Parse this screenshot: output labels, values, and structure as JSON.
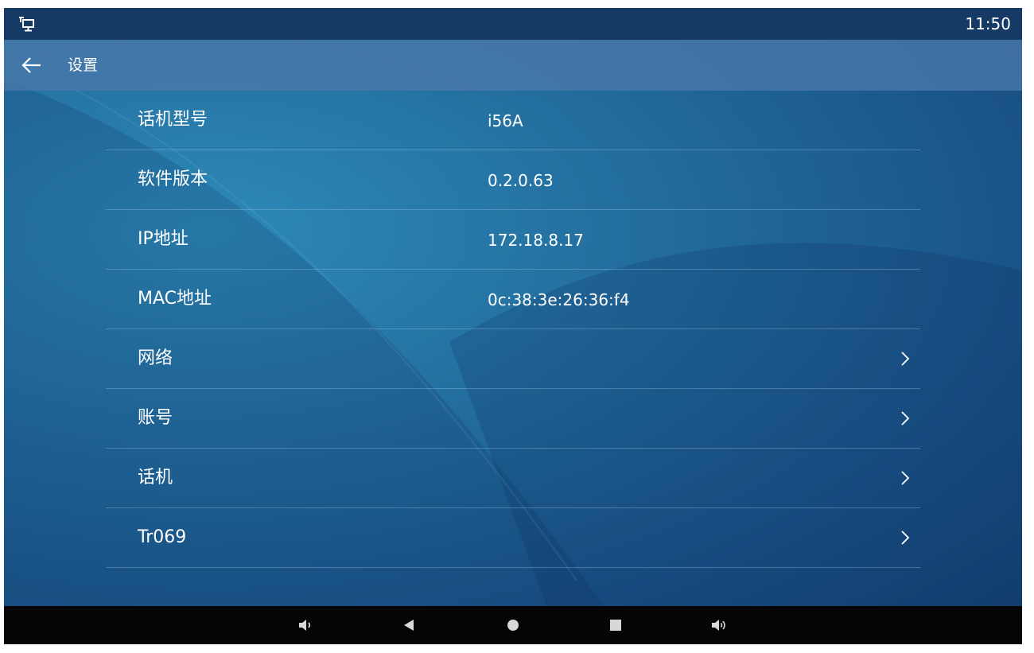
{
  "status_bar": {
    "time": "11:50",
    "left_icon": "network-monitor-icon"
  },
  "app_bar": {
    "back_icon": "arrow-left-icon",
    "title": "设置"
  },
  "settings": {
    "items": [
      {
        "label": "话机型号",
        "value": "i56A"
      },
      {
        "label": "软件版本",
        "value": "0.2.0.63"
      },
      {
        "label": "IP地址",
        "value": "172.18.8.17"
      },
      {
        "label": "MAC地址",
        "value": "0c:38:3e:26:36:f4"
      },
      {
        "label": "网络",
        "chevron_icon": "chevron-right-icon"
      },
      {
        "label": "账号",
        "chevron_icon": "chevron-right-icon"
      },
      {
        "label": "话机",
        "chevron_icon": "chevron-right-icon"
      },
      {
        "label": "Tr069",
        "chevron_icon": "chevron-right-icon"
      }
    ]
  },
  "nav_bar": {
    "buttons": [
      "volume-down-icon",
      "back-triangle-icon",
      "home-circle-icon",
      "recents-square-icon",
      "volume-up-icon"
    ]
  },
  "colors": {
    "status_bar": "#163a66",
    "app_bar": "#4a78aa",
    "background": "#236fa0",
    "nav_bar": "#050505",
    "text": "#ffffff"
  }
}
